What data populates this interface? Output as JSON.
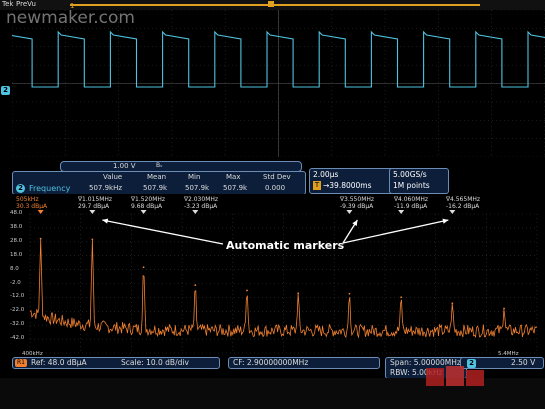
{
  "top": {
    "brand": "Tek",
    "mode": "PreVu",
    "watermark": "newmaker.com",
    "ch1_indicator": "1"
  },
  "time_domain": {
    "channel": "2",
    "scale_badge": "2",
    "scale": "1.00 V",
    "coupling_symbol": "Bᵥ"
  },
  "measurement": {
    "badge": "2",
    "label": "Frequency",
    "headers": [
      "Value",
      "Mean",
      "Min",
      "Max",
      "Std Dev"
    ],
    "values": [
      "507.9kHz",
      "507.9k",
      "507.9k",
      "507.9k",
      "0.000"
    ]
  },
  "horizontal": {
    "timebase": "2.00µs",
    "trigger_prefix": "T",
    "delay": "→39.8000ms"
  },
  "acquisition": {
    "sample_rate": "5.00GS/s",
    "record_length": "1M points"
  },
  "spectrum": {
    "ref_marker_freq": "505kHz",
    "ref_marker_amp": "30.3 dBµA",
    "markers": [
      {
        "freq": "∇1.015MHz",
        "amp": "29.7 dBµA"
      },
      {
        "freq": "∇1.520MHz",
        "amp": "9.68 dBµA"
      },
      {
        "freq": "∇2.030MHz",
        "amp": "-3.23 dBµA"
      },
      {
        "freq": "∇3.550MHz",
        "amp": "-9.39 dBµA"
      },
      {
        "freq": "∇4.060MHz",
        "amp": "-11.9 dBµA"
      },
      {
        "freq": "∇4.565MHz",
        "amp": "-16.2 dBµA"
      }
    ],
    "annotation": "Automatic markers",
    "y_ticks": [
      "48.0",
      "38.0",
      "28.0",
      "18.0",
      "8.0",
      "-2.0",
      "-12.0",
      "-22.0",
      "-32.0",
      "-42.0"
    ],
    "x_min": "400kHz",
    "x_max": "5.4MHz"
  },
  "bottom": {
    "ref_badge": "R1",
    "ref": "Ref: 48.0 dBµA",
    "scale": "Scale: 10.0 dB/div",
    "cf": "CF: 2.90000000MHz",
    "span": "Span:    5.00000MHz",
    "rbw": "RBW:      5.00kHz",
    "ch_badge": "2",
    "ch_scale": "2.50 V"
  },
  "colors": {
    "ch2": "#4fc3e0",
    "spectrum": "#f08030",
    "accent": "#e0a020",
    "readout_bg": "#0c1e3a"
  },
  "chart_data": {
    "type": "line",
    "title": "",
    "xlabel": "",
    "ylabel": "",
    "xlim": [
      0.4,
      5.4
    ],
    "ylim": [
      -52,
      48
    ],
    "peaks": [
      {
        "x": 0.505,
        "y": 30.3
      },
      {
        "x": 1.015,
        "y": 29.7
      },
      {
        "x": 1.52,
        "y": 9.68
      },
      {
        "x": 2.03,
        "y": -3.23
      },
      {
        "x": 2.54,
        "y": -7
      },
      {
        "x": 3.045,
        "y": -9
      },
      {
        "x": 3.55,
        "y": -9.39
      },
      {
        "x": 4.06,
        "y": -11.9
      },
      {
        "x": 4.565,
        "y": -16.2
      },
      {
        "x": 5.075,
        "y": -20
      }
    ],
    "noise_floor": -36
  }
}
